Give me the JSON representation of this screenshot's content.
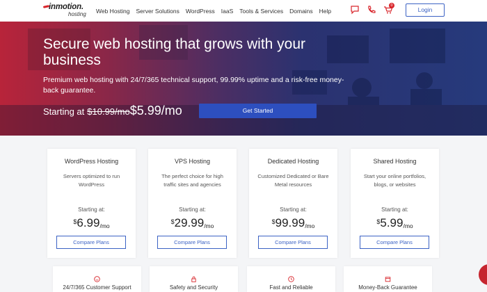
{
  "brand": {
    "name": "inmotion.",
    "sub": "hosting"
  },
  "menu": [
    "Web Hosting",
    "Server Solutions",
    "WordPress",
    "IaaS",
    "Tools & Services",
    "Domains",
    "Help"
  ],
  "cart_count": "0",
  "login_label": "Login",
  "hero": {
    "title": "Secure web hosting that grows with your business",
    "subtitle": "Premium web hosting with 24/7/365 technical support, 99.99% uptime and a risk-free money-back guarantee.",
    "price_prefix": "Starting at",
    "old_price": "$10.99/mo",
    "new_price": "$5.99/mo",
    "cta": "Get Started"
  },
  "plans": [
    {
      "title": "WordPress Hosting",
      "desc": "Servers optimized to run WordPress",
      "start": "Starting at:",
      "currency": "$",
      "amount": "6.99",
      "per": "/mo",
      "button": "Compare Plans"
    },
    {
      "title": "VPS Hosting",
      "desc": "The perfect choice for high traffic sites and agencies",
      "start": "Starting at:",
      "currency": "$",
      "amount": "29.99",
      "per": "/mo",
      "button": "Compare Plans"
    },
    {
      "title": "Dedicated Hosting",
      "desc": "Customized Dedicated or Bare Metal resources",
      "start": "Starting at:",
      "currency": "$",
      "amount": "99.99",
      "per": "/mo",
      "button": "Compare Plans"
    },
    {
      "title": "Shared Hosting",
      "desc": "Start your online portfolios, blogs, or websites",
      "start": "Starting at:",
      "currency": "$",
      "amount": "5.99",
      "per": "/mo",
      "button": "Compare Plans"
    }
  ],
  "features": [
    {
      "icon": "smile-icon",
      "label": "24/7/365 Customer Support"
    },
    {
      "icon": "lock-icon",
      "label": "Safety and Security"
    },
    {
      "icon": "clock-icon",
      "label": "Fast and Reliable"
    },
    {
      "icon": "calendar-icon",
      "label": "Money-Back Guarantee"
    }
  ],
  "colors": {
    "accent": "#d8252b",
    "primary": "#2d4fbf",
    "link": "#3b62c4"
  }
}
